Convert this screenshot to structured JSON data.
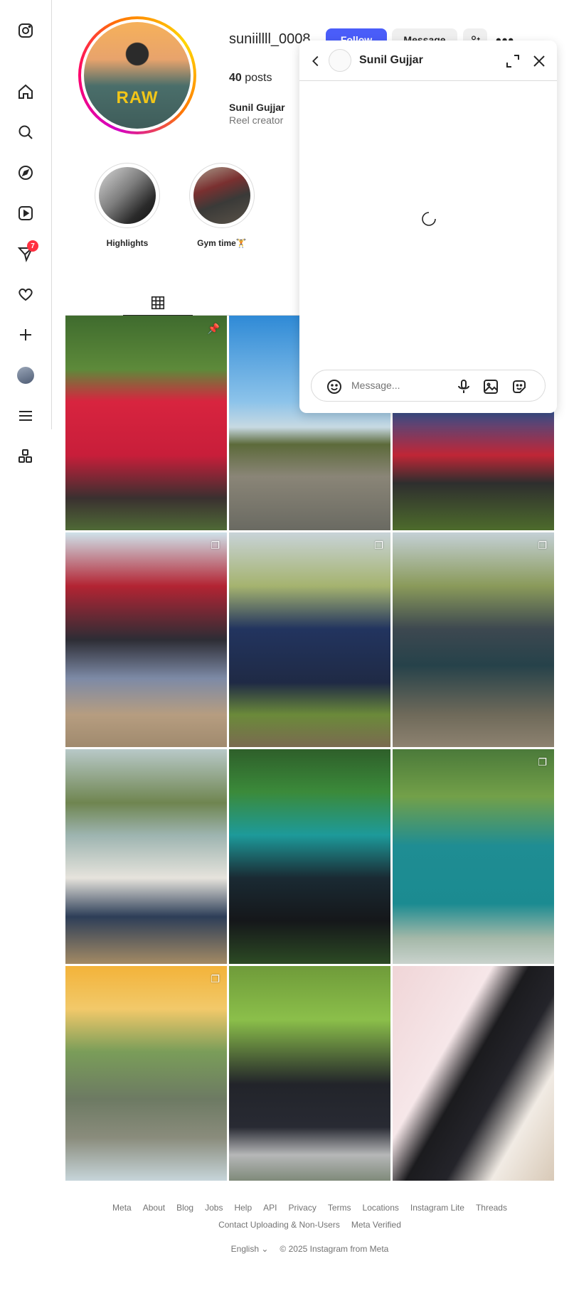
{
  "nav": {
    "items": [
      {
        "name": "instagram-logo-icon"
      },
      {
        "name": "home-icon"
      },
      {
        "name": "search-icon"
      },
      {
        "name": "explore-icon"
      },
      {
        "name": "reels-icon"
      },
      {
        "name": "messages-icon"
      },
      {
        "name": "notifications-icon"
      },
      {
        "name": "create-icon"
      },
      {
        "name": "profile-avatar"
      },
      {
        "name": "menu-icon"
      },
      {
        "name": "more-apps-icon"
      }
    ],
    "messages_badge": "7"
  },
  "profile": {
    "username": "suniillll_0008",
    "follow_label": "Follow",
    "message_label": "Message",
    "posts_count": "40",
    "posts_label": "posts",
    "full_name": "Sunil Gujjar",
    "category": "Reel creator",
    "avatar_logo": "RAW"
  },
  "highlights": [
    {
      "label": "Highlights"
    },
    {
      "label": "Gym time🏋️"
    }
  ],
  "posts": [
    {
      "icon": "pin-icon",
      "badge": "📌"
    },
    {
      "icon": "",
      "badge": ""
    },
    {
      "icon": "",
      "badge": ""
    },
    {
      "icon": "carousel-icon",
      "badge": "❐"
    },
    {
      "icon": "carousel-icon",
      "badge": "❐"
    },
    {
      "icon": "carousel-icon",
      "badge": "❐"
    },
    {
      "icon": "",
      "badge": ""
    },
    {
      "icon": "",
      "badge": ""
    },
    {
      "icon": "carousel-icon",
      "badge": "❐"
    },
    {
      "icon": "carousel-icon",
      "badge": "❐"
    },
    {
      "icon": "",
      "badge": ""
    },
    {
      "icon": "",
      "badge": ""
    }
  ],
  "dm": {
    "name": "Sunil Gujjar",
    "message_placeholder": "Message..."
  },
  "footer": {
    "links": [
      "Meta",
      "About",
      "Blog",
      "Jobs",
      "Help",
      "API",
      "Privacy",
      "Terms",
      "Locations",
      "Instagram Lite",
      "Threads"
    ],
    "links2": [
      "Contact Uploading & Non-Users",
      "Meta Verified"
    ],
    "language": "English",
    "copyright": "© 2025 Instagram from Meta"
  },
  "colors": {
    "accent": "#4a5df9",
    "badge": "#ff3040",
    "muted_text": "#737373",
    "border": "#dbdbdb"
  }
}
